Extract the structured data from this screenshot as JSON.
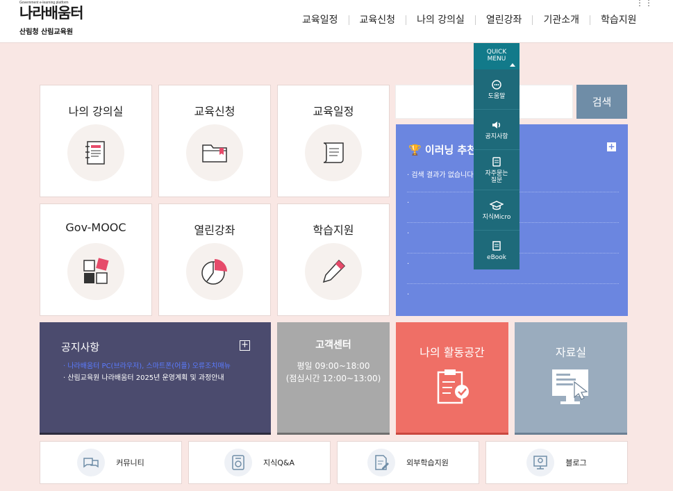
{
  "header": {
    "logo_small": "Government e-learning platform",
    "logo_brand": "나라배움터",
    "org": "산림청 산림교육원",
    "dots": "⋮⋮"
  },
  "nav": [
    "교육일정",
    "교육신청",
    "나의 강의실",
    "열린강좌",
    "기관소개",
    "학습지원"
  ],
  "tiles": [
    {
      "label": "나의 강의실",
      "icon": "notebook-icon"
    },
    {
      "label": "교육신청",
      "icon": "folder-icon"
    },
    {
      "label": "교육일정",
      "icon": "scroll-icon"
    },
    {
      "label": "Gov-MOOC",
      "icon": "squares-icon"
    },
    {
      "label": "열린강좌",
      "icon": "pie-icon"
    },
    {
      "label": "학습지원",
      "icon": "pencil-icon"
    }
  ],
  "search": {
    "button": "검색",
    "placeholder": ""
  },
  "elearning": {
    "title": "🏆 이러닝 추천",
    "items": [
      "· 검색 결과가 없습니다.",
      "·",
      "·",
      "·",
      "·"
    ]
  },
  "notice": {
    "title": "공지사항",
    "items": [
      "· 나라배움터 PC(브라우저), 스마트폰(어플) 오류조치매뉴",
      "· 산림교육원 나라배움터 2025년 운영계획 및 과정안내"
    ]
  },
  "customer_center": {
    "title": "고객센터",
    "hours1": "평일 09:00~18:00",
    "hours2": "(점심시간 12:00~13:00)"
  },
  "activity": {
    "title": "나의 활동공간"
  },
  "library": {
    "title": "자료실"
  },
  "bottom": [
    {
      "label": "커뮤니티",
      "icon": "chat-icon"
    },
    {
      "label": "지식Q&A",
      "icon": "qa-icon"
    },
    {
      "label": "외부학습지원",
      "icon": "edit-doc-icon"
    },
    {
      "label": "블로그",
      "icon": "blog-icon"
    }
  ],
  "quick_menu": {
    "title1": "QUICK",
    "title2": "MENU",
    "items": [
      {
        "label": "도움말",
        "icon": "help-icon"
      },
      {
        "label": "공지사항",
        "icon": "speaker-icon"
      },
      {
        "label1": "자주묻는",
        "label2": "질문",
        "icon": "faq-icon"
      },
      {
        "label": "지식Micro",
        "icon": "cap-icon"
      },
      {
        "label": "eBook",
        "icon": "book-icon"
      }
    ]
  },
  "colors": {
    "bg": "#f9e7e4",
    "elearn": "#6b86e0",
    "notice": "#4b4b6e",
    "quick": "#1e6a7a",
    "activity": "#ef6f66",
    "library": "#9aacbe"
  }
}
